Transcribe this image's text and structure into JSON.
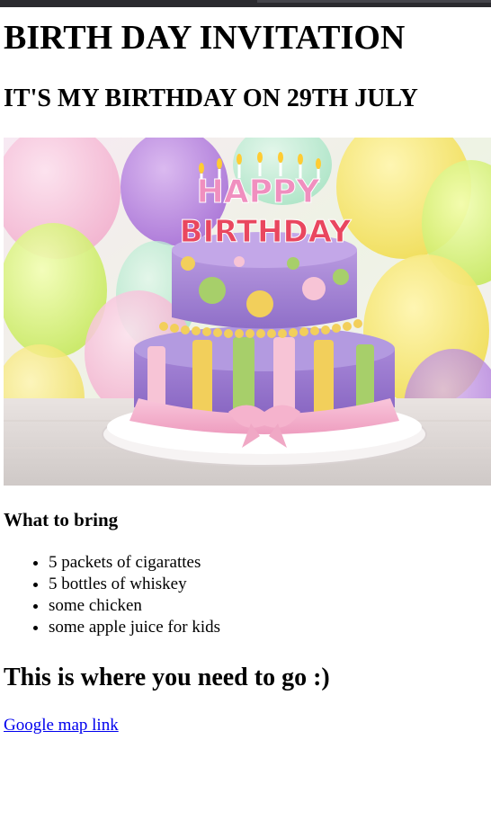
{
  "page": {
    "title": "BIRTH DAY INVITATION",
    "subtitle": "IT'S MY BIRTHDAY ON 29TH JULY"
  },
  "hero_image": {
    "alt": "Happy Birthday cake",
    "candle_text_top": "HAPPY",
    "candle_text_bottom": "BIRTHDAY"
  },
  "bring": {
    "heading": "What to bring",
    "items": [
      "5 packets of cigarattes",
      "5 bottles of whiskey",
      "some chicken",
      "some apple juice for kids"
    ]
  },
  "directions": {
    "heading": "This is where you need to go :)",
    "link_label": "Google map link"
  },
  "colors": {
    "link": "#0000ee",
    "text": "#000000",
    "cake_purple": "#9b7fd0",
    "cake_pink": "#f4b8cf",
    "cake_yellow": "#f2cf5b",
    "cake_green": "#a7cf6a"
  }
}
